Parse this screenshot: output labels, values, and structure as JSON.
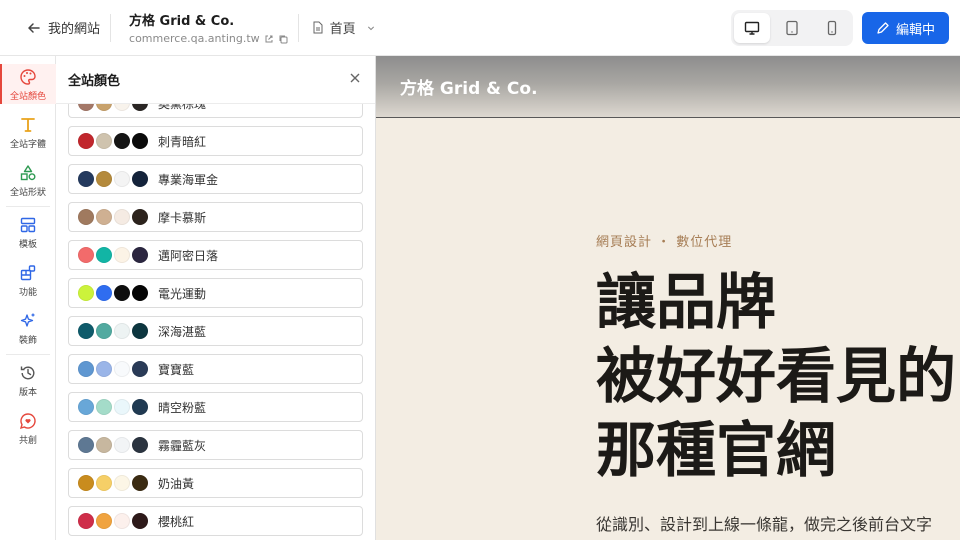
{
  "topbar": {
    "back_label": "我的網站",
    "site_name": "方格 Grid & Co.",
    "site_url": "commerce.qa.anting.tw",
    "page_label": "首頁",
    "edit_label": "編輯中"
  },
  "rail": {
    "items": [
      {
        "label": "全站顏色",
        "icon": "palette-icon"
      },
      {
        "label": "全站字體",
        "icon": "typography-icon"
      },
      {
        "label": "全站形狀",
        "icon": "shapes-icon"
      },
      {
        "label": "模板",
        "icon": "template-icon"
      },
      {
        "label": "功能",
        "icon": "widgets-icon"
      },
      {
        "label": "裝飾",
        "icon": "sparkles-icon"
      },
      {
        "label": "版本",
        "icon": "history-icon"
      },
      {
        "label": "共創",
        "icon": "heart-chat-icon"
      }
    ]
  },
  "panel": {
    "title": "全站顏色",
    "palettes": [
      {
        "name": "奧黛棕瑰",
        "colors": [
          "#a47868",
          "#c8a26c",
          "#f8f3ec",
          "#2a2624"
        ]
      },
      {
        "name": "刺青暗紅",
        "colors": [
          "#c1272d",
          "#cfc3ae",
          "#151515",
          "#0b0b0b"
        ]
      },
      {
        "name": "專業海軍金",
        "colors": [
          "#243a5e",
          "#b48a3c",
          "#f4f4f4",
          "#14233b"
        ]
      },
      {
        "name": "摩卡慕斯",
        "colors": [
          "#a07a5f",
          "#cfb092",
          "#f5ebe3",
          "#2c231d"
        ]
      },
      {
        "name": "邁阿密日落",
        "colors": [
          "#f26b6b",
          "#12b5a5",
          "#fcf3e6",
          "#2b2640"
        ]
      },
      {
        "name": "電光運動",
        "colors": [
          "#ccf33b",
          "#2f6df0",
          "#0e0e0e",
          "#050505"
        ]
      },
      {
        "name": "深海湛藍",
        "colors": [
          "#0f5b6b",
          "#52aaa0",
          "#edf3f3",
          "#0d3640"
        ]
      },
      {
        "name": "寶寶藍",
        "colors": [
          "#5f97d1",
          "#9ab5e8",
          "#f8fafc",
          "#2a3b57"
        ]
      },
      {
        "name": "晴空粉藍",
        "colors": [
          "#68a7d8",
          "#a4dcc9",
          "#eaf7fb",
          "#203a52"
        ]
      },
      {
        "name": "霧霾藍灰",
        "colors": [
          "#5e7893",
          "#c7b79f",
          "#f2f4f6",
          "#2b3440"
        ]
      },
      {
        "name": "奶油黃",
        "colors": [
          "#c98c1e",
          "#f6cf67",
          "#fcf6e6",
          "#3b2b12"
        ]
      },
      {
        "name": "櫻桃紅",
        "colors": [
          "#cf2e4a",
          "#f0a33f",
          "#fcf0ec",
          "#2e1a1a"
        ]
      }
    ]
  },
  "preview": {
    "brand": "方格 Grid & Co.",
    "eyebrow": "網頁設計 ・ 數位代理",
    "hero_line1": "讓品牌",
    "hero_line2": "被好好看見的",
    "hero_line3": "那種官網",
    "subtitle": "從識別、設計到上線一條龍，做完之後前台文字"
  },
  "colors": {
    "accent": "#1866e8",
    "rail_active": "#e5473c",
    "preview_bg": "#f3ede3",
    "eyebrow": "#a67d55"
  }
}
